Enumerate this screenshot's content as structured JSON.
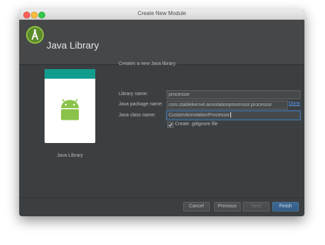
{
  "window": {
    "title": "Create New Module"
  },
  "header": {
    "title": "Java Library",
    "logo_icon": "android-studio-icon"
  },
  "preview": {
    "caption": "Java Library",
    "icon": "android-icon",
    "accent_color": "#129c8e"
  },
  "form": {
    "description": "Creates a new Java library.",
    "library_name": {
      "label": "Library name:",
      "value": "processor"
    },
    "package_name": {
      "label": "Java package name:",
      "value": "com.stablekernel.annotationprocessor.processor",
      "action": "Done"
    },
    "class_name": {
      "label": "Java class name:",
      "value": "CustomAnnotationProcessor"
    },
    "gitignore": {
      "label": "Create .gitignore file",
      "checked": true
    }
  },
  "footer": {
    "cancel": "Cancel",
    "previous": "Previous",
    "next": "Next",
    "finish": "Finish"
  }
}
